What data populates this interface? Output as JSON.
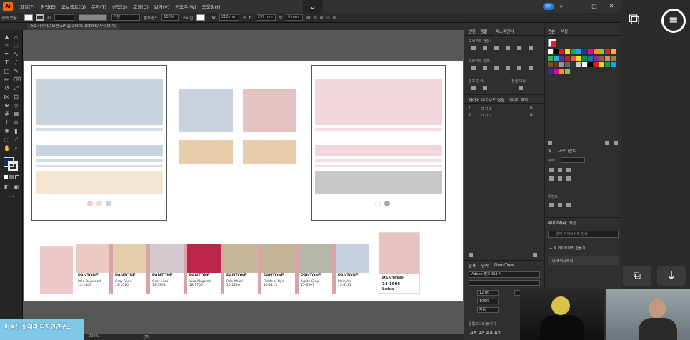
{
  "menu": {
    "items": [
      "파일(F)",
      "편집(E)",
      "오브젝트(O)",
      "문자(T)",
      "선택(S)",
      "효과(C)",
      "보기(V)",
      "윈도우(W)",
      "도움말(H)"
    ],
    "account_badge": "공유"
  },
  "control": {
    "selection_label": "선택 없음",
    "stroke_label": "획",
    "basic_label": "기본",
    "opacity_label": "불투명도",
    "opacity_value": "100%",
    "style_label": "스타일",
    "width_label": "W",
    "width_value": "210 mm",
    "height_label": "H",
    "height_value": "297 mm",
    "angle_value": "0 mm"
  },
  "document": {
    "tab_title": "스토리라이트모션.ai* @ 200% (CMYK/미리 보기)"
  },
  "artboard": {
    "pantone_cards": [
      {
        "brand": "PANTONE",
        "name": "Pale Dogwood",
        "code": "13-1404",
        "color": "#ecc9c1"
      },
      {
        "brand": "PANTONE",
        "name": "Gray Sand",
        "code": "13-1010",
        "color": "#e5ccaa"
      },
      {
        "brand": "PANTONE",
        "name": "Gray Lilac",
        "code": "13-3804",
        "color": "#d4c9ce"
      },
      {
        "brand": "PANTONE",
        "name": "Viva Magenta",
        "code": "18-1750",
        "color": "#be2649"
      },
      {
        "brand": "PANTONE",
        "name": "Pale Khaki",
        "code": "15-1216",
        "color": "#c7b79b"
      },
      {
        "brand": "PANTONE",
        "name": "Fields of Rye",
        "code": "15-1115",
        "color": "#c4b396"
      },
      {
        "brand": "PANTONE",
        "name": "Agate Gray",
        "code": "15-6307",
        "color": "#b7b7a8"
      },
      {
        "brand": "PANTONE",
        "name": "Plein Air",
        "code": "13-4111",
        "color": "#c5cfdd"
      }
    ],
    "lotus": {
      "brand": "PANTONE",
      "code": "14-1905",
      "name": "Lotus",
      "color": "#e7c2c0"
    }
  },
  "panels": {
    "tabs_top": [
      "변환",
      "정렬",
      "패스파인더"
    ],
    "align_objects": "오브젝트 정렬:",
    "distribute_objects": "오브젝트 분포:",
    "distribute_spacing": "분포 간격:",
    "align_to": "정렬 대상:",
    "layers_tabs": [
      "레이어",
      "아트보드",
      "연결",
      "이미지 추적"
    ],
    "layers": [
      {
        "num": "1",
        "name": "대지 1"
      },
      {
        "num": "2",
        "name": "대지 2"
      }
    ],
    "swatches_tabs": [
      "견본",
      "색상"
    ],
    "stroke_tabs": [
      "획",
      "그라디언트"
    ],
    "weight_label": "두께:",
    "transparency_label": "투명도",
    "libraries_tabs": [
      "라이브러리",
      "속성"
    ],
    "library_search": "현재 라이브러리 검색",
    "new_library": "+ 새 라이브러리 만들기",
    "my_library": "내 라이브러리",
    "char_tabs": [
      "문자",
      "단락",
      "OpenType"
    ],
    "font_name": "Adobe 명조 Std M",
    "font_size": "12 pt",
    "leading": "100%",
    "tracking": "자동",
    "clipboard_label": "클립보드로 붙이기"
  },
  "status": {
    "zoom": "200%",
    "tool": "선택"
  },
  "overlay": {
    "banner": "이승신 칼레리 디자인연구소"
  }
}
